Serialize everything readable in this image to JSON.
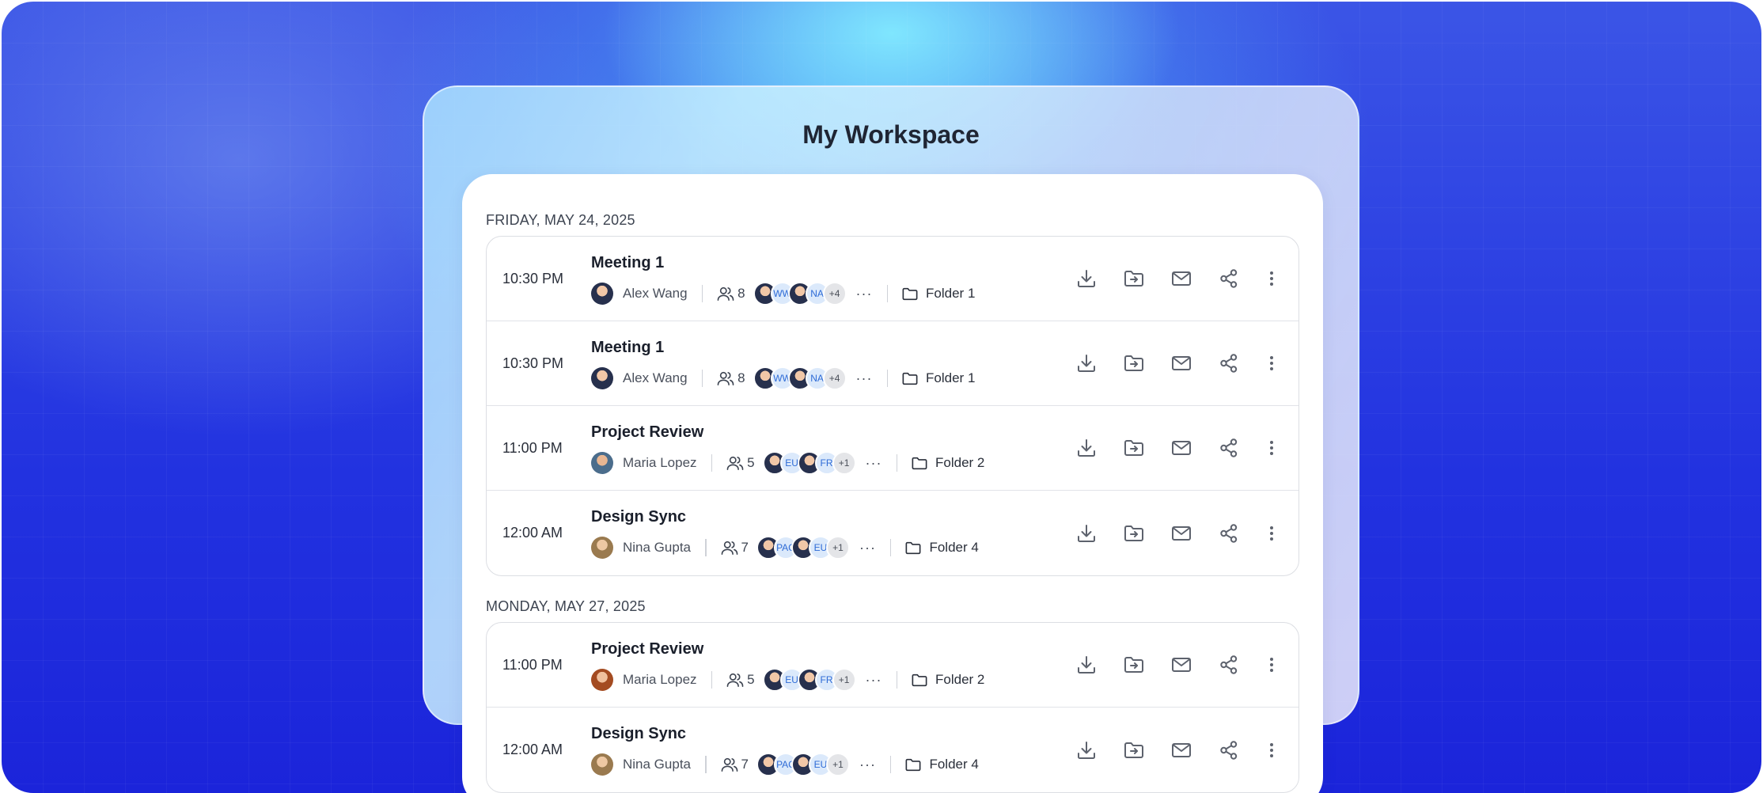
{
  "app": {
    "title": "My Workspace"
  },
  "groups": [
    {
      "date": "FRIDAY, MAY 24, 2025",
      "meetings": [
        {
          "time": "10:30 PM",
          "title": "Meeting 1",
          "owner": "Alex Wang",
          "owner_avatar": "av-a",
          "attendees": "8",
          "chips": [
            {
              "type": "photo",
              "label": ""
            },
            {
              "type": "initials",
              "label": "WW"
            },
            {
              "type": "photo",
              "label": ""
            },
            {
              "type": "initials",
              "label": "NA"
            },
            {
              "type": "more",
              "label": "+4"
            }
          ],
          "folder": "Folder 1"
        },
        {
          "time": "10:30 PM",
          "title": "Meeting 1",
          "owner": "Alex Wang",
          "owner_avatar": "av-a",
          "attendees": "8",
          "chips": [
            {
              "type": "photo",
              "label": ""
            },
            {
              "type": "initials",
              "label": "WW"
            },
            {
              "type": "photo",
              "label": ""
            },
            {
              "type": "initials",
              "label": "NA"
            },
            {
              "type": "more",
              "label": "+4"
            }
          ],
          "folder": "Folder 1"
        },
        {
          "time": "11:00 PM",
          "title": "Project Review",
          "owner": "Maria Lopez",
          "owner_avatar": "av-b",
          "attendees": "5",
          "chips": [
            {
              "type": "photo",
              "label": ""
            },
            {
              "type": "initials",
              "label": "EU"
            },
            {
              "type": "photo",
              "label": ""
            },
            {
              "type": "initials",
              "label": "FR"
            },
            {
              "type": "more",
              "label": "+1"
            }
          ],
          "folder": "Folder 2"
        },
        {
          "time": "12:00 AM",
          "title": "Design Sync",
          "owner": "Nina Gupta",
          "owner_avatar": "av-c",
          "attendees": "7",
          "chips": [
            {
              "type": "photo",
              "label": ""
            },
            {
              "type": "initials",
              "label": "PAC"
            },
            {
              "type": "photo",
              "label": ""
            },
            {
              "type": "initials",
              "label": "EU"
            },
            {
              "type": "more",
              "label": "+1"
            }
          ],
          "folder": "Folder 4"
        }
      ]
    },
    {
      "date": "MONDAY, MAY 27, 2025",
      "meetings": [
        {
          "time": "11:00 PM",
          "title": "Project Review",
          "owner": "Maria Lopez",
          "owner_avatar": "av-d",
          "attendees": "5",
          "chips": [
            {
              "type": "photo",
              "label": ""
            },
            {
              "type": "initials",
              "label": "EU"
            },
            {
              "type": "photo",
              "label": ""
            },
            {
              "type": "initials",
              "label": "FR"
            },
            {
              "type": "more",
              "label": "+1"
            }
          ],
          "folder": "Folder 2"
        },
        {
          "time": "12:00 AM",
          "title": "Design Sync",
          "owner": "Nina Gupta",
          "owner_avatar": "av-c",
          "attendees": "7",
          "chips": [
            {
              "type": "photo",
              "label": ""
            },
            {
              "type": "initials",
              "label": "PAC"
            },
            {
              "type": "photo",
              "label": ""
            },
            {
              "type": "initials",
              "label": "EU"
            },
            {
              "type": "more",
              "label": "+1"
            }
          ],
          "folder": "Folder 4"
        }
      ]
    }
  ],
  "icons": {
    "attendees": "people-icon",
    "folder": "folder-icon",
    "actions": [
      "download-icon",
      "move-to-folder-icon",
      "mail-icon",
      "share-icon",
      "more-vertical-icon"
    ]
  },
  "colors": {
    "background_deep": "#1b24da",
    "background_glow": "#82ebff",
    "card": "#ffffff",
    "initials_text": "#2e6bd6"
  }
}
